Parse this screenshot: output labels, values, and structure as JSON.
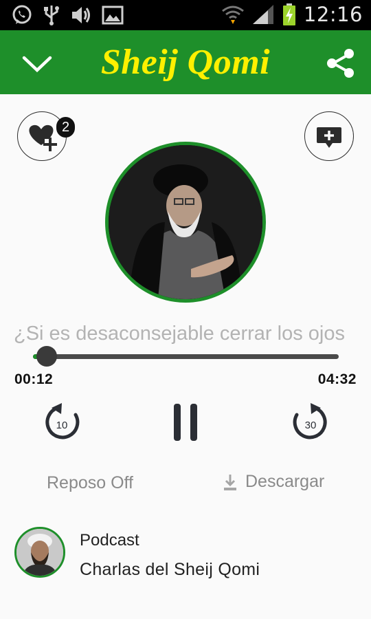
{
  "status_bar": {
    "time": "12:16",
    "icons": [
      "whatsapp-icon",
      "usb-icon",
      "volume-icon",
      "image-icon",
      "wifi-icon",
      "signal-icon",
      "battery-charging-icon"
    ]
  },
  "app_bar": {
    "title": "Sheij Qomi",
    "left_icon": "chevron-down-icon",
    "right_icon": "share-icon",
    "colors": {
      "background": "#1e8f2a",
      "title": "#fff000"
    }
  },
  "favorite": {
    "count": "2",
    "icon": "heart-add-icon"
  },
  "comment": {
    "icon": "comment-add-icon"
  },
  "track": {
    "title": "¿Si es desaconsejable cerrar los ojos",
    "current_time": "00:12",
    "total_time": "04:32",
    "progress_fraction": 0.044
  },
  "controls": {
    "rewind_seconds": "10",
    "forward_seconds": "30",
    "state_icon": "pause-icon",
    "sleep_label": "Reposo Off",
    "download_label": "Descargar"
  },
  "podcast": {
    "label": "Podcast",
    "name": "Charlas del Sheij Qomi"
  }
}
